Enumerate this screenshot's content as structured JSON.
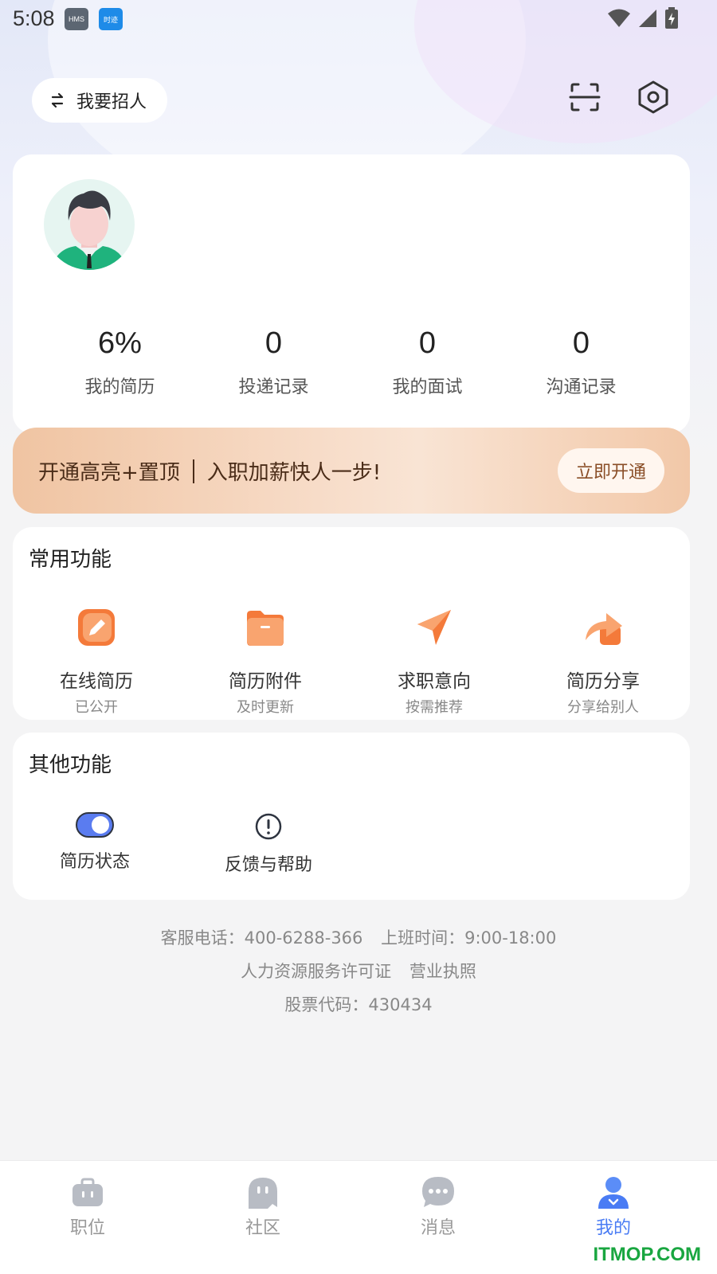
{
  "status_bar": {
    "time": "5:08",
    "badge_hms": "HMS",
    "badge_app": "时迹"
  },
  "header": {
    "recruit_label": "我要招人",
    "icons": [
      "switch-icon",
      "scan-icon",
      "settings-icon"
    ]
  },
  "profile": {
    "avatar": "avatar-icon",
    "stats": [
      {
        "value": "6%",
        "label": "我的简历"
      },
      {
        "value": "0",
        "label": "投递记录"
      },
      {
        "value": "0",
        "label": "我的面试"
      },
      {
        "value": "0",
        "label": "沟通记录"
      }
    ]
  },
  "promo": {
    "text_left": "开通高亮+置顶",
    "text_right": "入职加薪快人一步!",
    "button_label": "立即开通"
  },
  "common": {
    "title": "常用功能",
    "items": [
      {
        "label": "在线简历",
        "sub": "已公开",
        "icon": "edit-icon"
      },
      {
        "label": "简历附件",
        "sub": "及时更新",
        "icon": "folder-icon"
      },
      {
        "label": "求职意向",
        "sub": "按需推荐",
        "icon": "send-icon"
      },
      {
        "label": "简历分享",
        "sub": "分享给别人",
        "icon": "share-icon"
      }
    ]
  },
  "other": {
    "title": "其他功能",
    "items": [
      {
        "label": "简历状态",
        "icon": "toggle-icon"
      },
      {
        "label": "反馈与帮助",
        "icon": "alert-icon"
      }
    ]
  },
  "info": {
    "phone": "客服电话：400-6288-366",
    "hours": "上班时间：9:00-18:00",
    "license": "人力资源服务许可证",
    "business": "营业执照",
    "stock": "股票代码：430434"
  },
  "tabs": [
    {
      "label": "职位",
      "icon": "briefcase-icon"
    },
    {
      "label": "社区",
      "icon": "ghost-icon"
    },
    {
      "label": "消息",
      "icon": "chat-icon"
    },
    {
      "label": "我的",
      "icon": "person-icon",
      "active": true
    }
  ],
  "watermark": "ITMOP.COM",
  "colors": {
    "accent": "#4a7cf4",
    "orange": "#f47a3a",
    "promo_text": "#4a2c18"
  }
}
